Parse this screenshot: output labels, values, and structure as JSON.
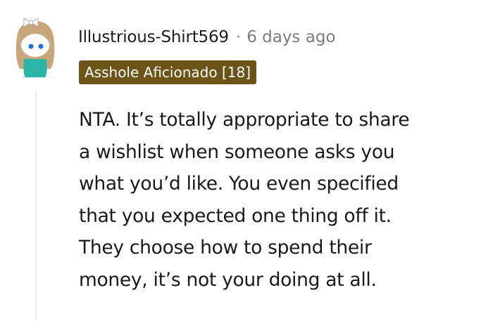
{
  "comment": {
    "author": "Illustrious-Shirt569",
    "separator": "·",
    "timestamp": "6 days ago",
    "flair": "Asshole Aficionado [18]",
    "body_lines": [
      "NTA. It’s totally appropriate to share",
      "a wishlist when someone asks you",
      "what you’d like. You even specified",
      "that you expected one thing off it.",
      "They choose how to spend their",
      "money, it’s not your doing at all."
    ]
  },
  "colors": {
    "flair_background": "#6b5416",
    "flair_text": "#ffffff",
    "username": "#1c1c1c",
    "timestamp": "#7c7c7c",
    "body_text": "#1a1a1b",
    "thread_line": "#edeff1"
  },
  "icons": {
    "avatar": "snoo-avatar-icon"
  }
}
